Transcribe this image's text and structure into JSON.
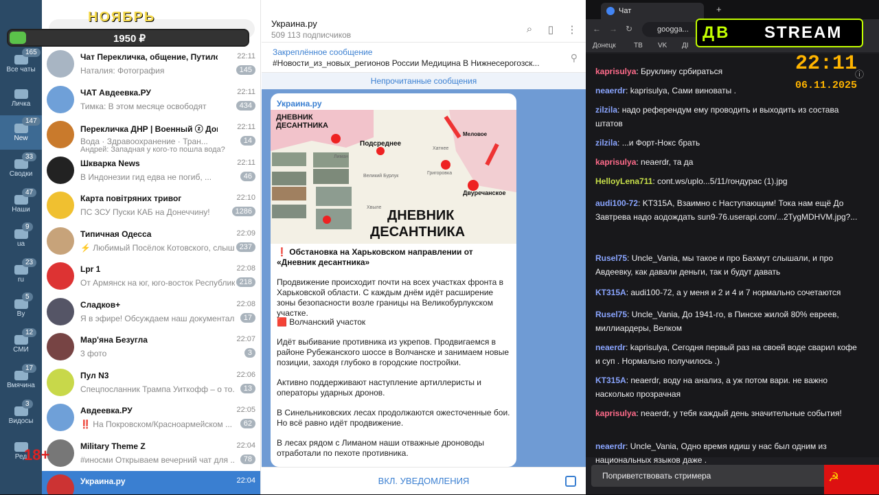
{
  "promo": {
    "month": "НОЯБРЬ",
    "amount": "1950 ₽",
    "progress_fraction": 0.07
  },
  "age_label": "18+",
  "rail": [
    {
      "label": "Все чаты",
      "count": "165"
    },
    {
      "label": "Личка",
      "count": ""
    },
    {
      "label": "New",
      "count": "147"
    },
    {
      "label": "Сводки",
      "count": "33"
    },
    {
      "label": "Наши",
      "count": "47"
    },
    {
      "label": "ua",
      "count": "9"
    },
    {
      "label": "ru",
      "count": "23"
    },
    {
      "label": "By",
      "count": "5"
    },
    {
      "label": "СМИ",
      "count": "12"
    },
    {
      "label": "Вмячина",
      "count": "17"
    },
    {
      "label": "Видосы",
      "count": "3"
    },
    {
      "label": "Ред",
      "count": ""
    }
  ],
  "chats": [
    {
      "name": "Чат Перекличка, общение, Путиловк...",
      "time": "22:11",
      "preview": "Наталия: Фотография",
      "badge": "145"
    },
    {
      "name": "ЧАТ Авдеевка.РУ",
      "time": "22:11",
      "preview": "Тимка: В этом месяце освободят",
      "badge": "434"
    },
    {
      "name": "Перекличка ДНР | Военный ⓩ Доне...",
      "time": "22:11",
      "preview": "Вода · Здравоохранение · Тран...",
      "preview2": "Андрей: Западная у кого-то пошла вода?",
      "badge": "14"
    },
    {
      "name": "Шкварка News",
      "time": "22:11",
      "preview": "В Индонезии гид едва не погиб, ...",
      "badge": "46"
    },
    {
      "name": "Карта повітряних тривог",
      "time": "22:10",
      "preview": "ПС ЗСУ Пуски КАБ на Донеччину!",
      "badge": "1286"
    },
    {
      "name": "Типичная Одесса",
      "time": "22:09",
      "preview": "⚡ Любимый Посёлок Котовского, слышн...",
      "badge": "237"
    },
    {
      "name": "Lpr 1",
      "time": "22:08",
      "preview": "От Армянск на юг, юго-восток Республик...",
      "badge": "218"
    },
    {
      "name": "Сладков+",
      "time": "22:08",
      "preview": "Я в эфире! Обсуждаем наш документальн...",
      "badge": "17"
    },
    {
      "name": "Мар'яна Безугла",
      "time": "22:07",
      "preview": "3 фото",
      "badge": "3"
    },
    {
      "name": "Пул N3",
      "time": "22:06",
      "preview": "Спецпосланник Трампа Уиткофф – о то...",
      "badge": "13"
    },
    {
      "name": "Авдеевка.РУ",
      "time": "22:05",
      "preview": "‼️ На Покровском/Красноармейском ...",
      "badge": "62"
    },
    {
      "name": "Military Theme Z",
      "time": "22:04",
      "preview": "#иносми Открываем вечерний чат для ...",
      "badge": "78"
    },
    {
      "name": "Украина.ру",
      "time": "22:04",
      "preview": "",
      "badge": ""
    }
  ],
  "channel": {
    "title": "Украина.ру",
    "subscribers": "509 113 подписчиков"
  },
  "pinned": {
    "title": "Закреплённое сообщение",
    "text": "#Новости_из_новых_регионов России  Медицина  В Нижнесерогозск..."
  },
  "unread_label": "Непрочитанные сообщения",
  "post": {
    "from": "Украина.ру",
    "map": {
      "caption_top": "ДНЕВНИК ДЕСАНТНИКА",
      "caption_bottom": "ДНЕВНИК ДЕСАНТНИКА",
      "places": [
        "Подсреднее",
        "Меловое",
        "Двуречанское",
        "Хатнее",
        "Великий Бурлук",
        "Григоровка",
        "Лиман",
        "Старый Салтов",
        "Хвыле"
      ]
    },
    "headline": "❗ Обстановка на Харьковском направлении от «Дневник десантника»",
    "p1": "Продвижение происходит почти на всех участках фронта в Харьковской области. С каждым днём идёт расширение зоны безопасности возле границы на Великобурлукском участке.",
    "p2": "🟥 Волчанский участок",
    "p3": "Идёт выбивание противника из укрепов. Продвигаемся в районе Рубежанского шоссе в Волчанске и занимаем новые позиции, заходя глубоко в городские постройки.",
    "p4": "Активно поддерживают наступление артиллеристы и операторы ударных дронов.",
    "p5": "В Синельниковских лесах продолжаются ожесточенные бои. Но всё равно идёт продвижение.",
    "p6": "В лесах рядом с Лиманом наши отважные дроноводы отработали по пехоте противника."
  },
  "footer_button": "ВКЛ. УВЕДОМЛЕНИЯ",
  "browser": {
    "tab_title": "Чат",
    "url": "googga...",
    "bookmarks": [
      "Донецк",
      "ТВ",
      "VK",
      "ДІ"
    ]
  },
  "stream_logo": {
    "left": "ДВ",
    "right": "STREAM"
  },
  "clock": "22:11",
  "date": "06.11.2025",
  "colors": {
    "telegram_accent": "#3a7fd1",
    "rail": "#2b4a66",
    "twitch_bg": "#18181b",
    "logo_green": "#c3ff00",
    "clock_orange": "#ffb400"
  },
  "messages": [
    {
      "user": "kaprisulya",
      "color": "#ff6b8a",
      "text": "Бруклину србираться"
    },
    {
      "user": "neaerdr",
      "color": "#8aa5ff",
      "text": "kaprisulya, Сами виноваты ."
    },
    {
      "user": "zilzila",
      "color": "#8aa5ff",
      "text": "надо референдум ему проводить и выходить из состава штатов"
    },
    {
      "user": "zilzila",
      "color": "#8aa5ff",
      "text": "...и Форт-Нокс брать"
    },
    {
      "user": "kaprisulya",
      "color": "#ff6b8a",
      "text": "neaerdr, та да"
    },
    {
      "user": "HelloyLena711",
      "color": "#c8e04a",
      "text": "cont.ws/uplo...5/11/гондурас (1).jpg"
    },
    {
      "user": "audi100-72",
      "color": "#8aa5ff",
      "text": "KT315A, Взаимно с Наступающим! Тока нам ещё До Завтрева надо аодождать sun9-76.userapi.com/...2TygMDHVM.jpg?..."
    },
    {
      "user": "Rusel75",
      "color": "#8aa5ff",
      "text": "Uncle_Vania, мы такое и про Бахмут слышали, и про Авдеевку, как давали деньги, так и будут давать"
    },
    {
      "user": "KT315A",
      "color": "#8aa5ff",
      "text": "audi100-72, а у меня и 2 и 4 и 7 нормально сочетаются"
    },
    {
      "user": "Rusel75",
      "color": "#8aa5ff",
      "text": "Uncle_Vania, До 1941-го, в Пинске жилой 80% евреев, миллиардеры, Велком"
    },
    {
      "user": "neaerdr",
      "color": "#8aa5ff",
      "text": "kaprisulya, Сегодня первый раз на своей воде сварил кофе и суп . Нормально получилось .)"
    },
    {
      "user": "KT315A",
      "color": "#8aa5ff",
      "text": "neaerdr, воду на анализ, а уж потом вари. не важно насколько прозрачная"
    },
    {
      "user": "kaprisulya",
      "color": "#ff6b8a",
      "text": "neaerdr, у тебя каждый день значительные события!"
    },
    {
      "user": "neaerdr",
      "color": "#8aa5ff",
      "text": "Uncle_Vania, Одно время идиш у нас был одним из национальных языков даже ."
    }
  ],
  "greet_button": "Поприветствовать стримера"
}
